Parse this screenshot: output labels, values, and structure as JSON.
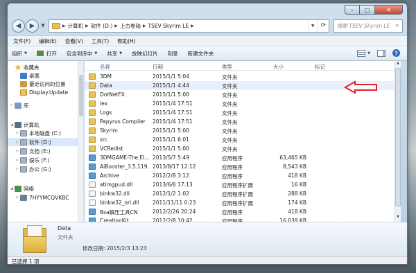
{
  "window": {
    "controls": [
      "–",
      "□",
      "✕"
    ]
  },
  "address": {
    "crumbs": [
      "计算机",
      "软件 (D:)",
      "上古卷轴",
      "TSEV Skyrim LE"
    ],
    "search_placeholder": "搜索 TSEV Skyrim LE"
  },
  "menubar": [
    "文件(F)",
    "编辑(E)",
    "查看(V)",
    "工具(T)",
    "帮助(H)"
  ],
  "cmdbar": {
    "organize": "组织",
    "open": "打开",
    "include_library": "包含到库中",
    "share": "共享",
    "slideshow": "放映幻灯片",
    "burn": "刻录",
    "new_folder": "新建文件夹"
  },
  "navpane": [
    {
      "label": "收藏夹",
      "icon": "star-icon",
      "expand": "",
      "indent": 0
    },
    {
      "label": "桌面",
      "icon": "desktop-icon",
      "expand": "",
      "indent": 1
    },
    {
      "label": "最近访问的位置",
      "icon": "recent-places-icon",
      "expand": "",
      "indent": 1
    },
    {
      "label": "Display.Update",
      "icon": "folder-icon",
      "expand": "",
      "indent": 1
    },
    {
      "label": "库",
      "icon": "library-icon",
      "expand": "▷",
      "indent": 0
    },
    {
      "label": "计算机",
      "icon": "computer-icon",
      "expand": "◢",
      "indent": 0
    },
    {
      "label": "本地磁盘 (C:)",
      "icon": "drive-icon",
      "expand": "▷",
      "indent": 1
    },
    {
      "label": "软件 (D:)",
      "icon": "drive-icon",
      "expand": "▷",
      "indent": 1,
      "selected": true
    },
    {
      "label": "文档 (E:)",
      "icon": "drive-icon",
      "expand": "▷",
      "indent": 1
    },
    {
      "label": "娱乐 (F:)",
      "icon": "drive-icon",
      "expand": "▷",
      "indent": 1
    },
    {
      "label": "办公 (G:)",
      "icon": "drive-icon",
      "expand": "▷",
      "indent": 1
    },
    {
      "label": "网络",
      "icon": "network-icon",
      "expand": "◢",
      "indent": 0
    },
    {
      "label": "7HYYMCQVKBC",
      "icon": "network-computer-icon",
      "expand": "▷",
      "indent": 1
    }
  ],
  "columns": {
    "name": "名称",
    "date": "日期",
    "type": "类型",
    "size": "大小",
    "tags": "标记"
  },
  "files": [
    {
      "name": "3DM",
      "date": "2015/1/1 5:04",
      "type": "文件夹",
      "size": "",
      "icon": "folder"
    },
    {
      "name": "Data",
      "date": "2015/1/1 4:44",
      "type": "文件夹",
      "size": "",
      "icon": "folder",
      "selected": true
    },
    {
      "name": "DotNetFX",
      "date": "2015/1/1 5:00",
      "type": "文件夹",
      "size": "",
      "icon": "folder"
    },
    {
      "name": "lex",
      "date": "2015/1/4 17:51",
      "type": "文件夹",
      "size": "",
      "icon": "folder"
    },
    {
      "name": "Logs",
      "date": "2015/1/4 17:51",
      "type": "文件夹",
      "size": "",
      "icon": "folder"
    },
    {
      "name": "Papyrus Compiler",
      "date": "2015/1/4 17:51",
      "type": "文件夹",
      "size": "",
      "icon": "folder"
    },
    {
      "name": "Skyrim",
      "date": "2015/1/1 5:00",
      "type": "文件夹",
      "size": "",
      "icon": "folder"
    },
    {
      "name": "src",
      "date": "2015/1/1 6:01",
      "type": "文件夹",
      "size": "",
      "icon": "folder"
    },
    {
      "name": "VCRedist",
      "date": "2015/1/1 5:00",
      "type": "文件夹",
      "size": "",
      "icon": "folder"
    },
    {
      "name": "3DMGAME-The.El...",
      "date": "2013/5/7 5:49",
      "type": "应用程序",
      "size": "63,465 KB",
      "icon": "app"
    },
    {
      "name": "AiBooster_3.5.119...",
      "date": "2013/8/17 12:12",
      "type": "应用程序",
      "size": "8,543 KB",
      "icon": "app"
    },
    {
      "name": "Archive",
      "date": "2012/2/8 3:12",
      "type": "应用程序",
      "size": "418 KB",
      "icon": "app"
    },
    {
      "name": "atimgpud.dll",
      "date": "2013/6/6 17:13",
      "type": "应用程序扩展",
      "size": "16 KB",
      "icon": "dll"
    },
    {
      "name": "binkw32.dll",
      "date": "2012/1/2 1:02",
      "type": "应用程序扩展",
      "size": "288 KB",
      "icon": "dll"
    },
    {
      "name": "binkw32_ori.dll",
      "date": "2011/11/11 0:23",
      "type": "应用程序扩展",
      "size": "174 KB",
      "icon": "dll"
    },
    {
      "name": "Bsa解压工具CN",
      "date": "2012/2/26 20:24",
      "type": "应用程序",
      "size": "418 KB",
      "icon": "app"
    },
    {
      "name": "CreationKit",
      "date": "2012/2/8 10:42",
      "type": "应用程序",
      "size": "16,039 KB",
      "icon": "app"
    }
  ],
  "details": {
    "name": "Data",
    "type": "文件夹",
    "modified": "修改日期: 2015/2/3 13:23"
  },
  "status": "已选择 1 项",
  "annotation_color": "#e0202a"
}
